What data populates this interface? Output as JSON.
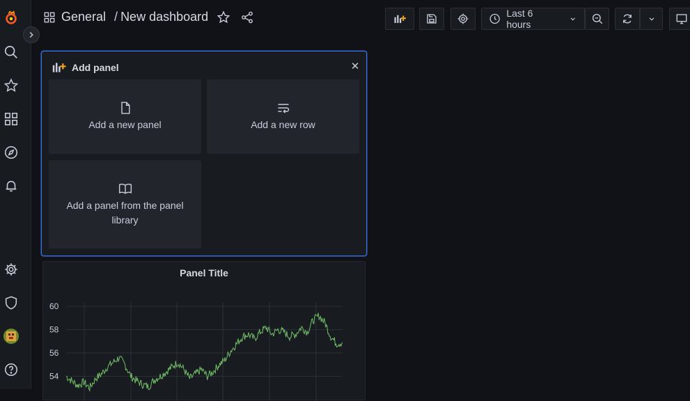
{
  "breadcrumb": {
    "folder": "General",
    "separator": "/",
    "dashboard": "New dashboard"
  },
  "toolbar": {
    "time_range": "Last 6 hours"
  },
  "add_panel": {
    "title": "Add panel",
    "options": [
      "Add a new panel",
      "Add a new row",
      "Add a panel from the panel library"
    ],
    "library_line1": "Add a panel from the panel",
    "library_line2": "library"
  },
  "panel": {
    "title": "Panel Title",
    "y_ticks": [
      "60",
      "58",
      "56",
      "54"
    ]
  },
  "chart_data": {
    "type": "line",
    "title": "Panel Title",
    "series": [
      {
        "values": [
          54.0,
          53.6,
          53.2,
          53.5,
          53.0,
          53.8,
          54.2,
          54.8,
          55.2,
          55.6,
          55.0,
          54.0,
          53.6,
          53.3,
          53.1,
          53.7,
          54.0,
          54.4,
          54.8,
          55.2,
          54.6,
          53.8,
          54.2,
          54.6,
          54.0,
          54.4,
          55.0,
          55.4,
          56.2,
          56.8,
          57.4,
          57.6,
          57.2,
          57.8,
          58.2,
          57.6,
          58.0,
          57.8,
          57.4,
          57.6,
          58.2,
          57.8,
          58.8,
          59.2,
          58.6,
          57.4,
          56.8,
          56.9
        ]
      }
    ],
    "y_ticks": [
      54,
      56,
      58,
      60
    ]
  },
  "colors": {
    "accent": "#3d71d9",
    "series": "#73bf69",
    "logo": "#f05a28"
  }
}
